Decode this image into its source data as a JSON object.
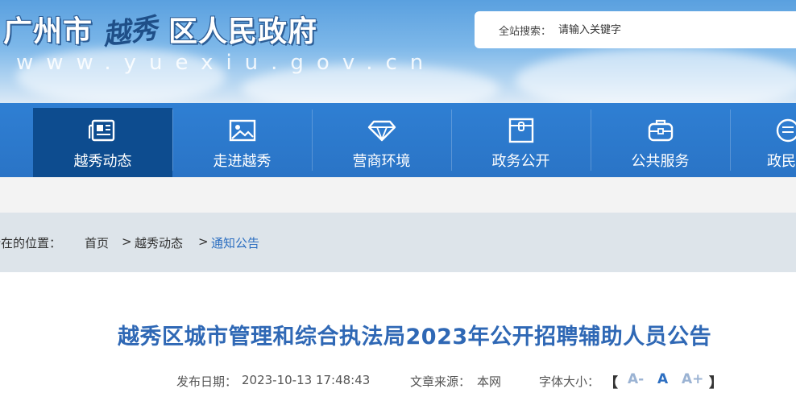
{
  "header": {
    "city": "广州市",
    "district_calligraphy": "越秀",
    "government": "区人民政府",
    "url": "www.yuexiu.gov.cn"
  },
  "search": {
    "label": "全站搜索：",
    "placeholder": "请输入关键字"
  },
  "nav": {
    "items": [
      {
        "label": "越秀动态",
        "icon": "newspaper-icon",
        "active": true
      },
      {
        "label": "走进越秀",
        "icon": "picture-icon",
        "active": false
      },
      {
        "label": "营商环境",
        "icon": "diamond-icon",
        "active": false
      },
      {
        "label": "政务公开",
        "icon": "folder-icon",
        "active": false
      },
      {
        "label": "公共服务",
        "icon": "briefcase-icon",
        "active": false
      },
      {
        "label": "政民",
        "icon": "chat-icon",
        "active": false
      }
    ]
  },
  "breadcrumb": {
    "prefix": "所在的位置：",
    "items": [
      "首页",
      "越秀动态",
      "通知公告"
    ],
    "separator": ">"
  },
  "article": {
    "title": "越秀区城市管理和综合执法局2023年公开招聘辅助人员公告",
    "date_label": "发布日期：",
    "date_value": "2023-10-13 17:48:43",
    "source_label": "文章来源：",
    "source_value": "本网",
    "font_size_label": "字体大小：",
    "bracket_open": "【",
    "font_decrease": "A-",
    "font_normal": "A",
    "font_increase": "A+",
    "bracket_close": "】"
  },
  "colors": {
    "nav_bg": "#2f7fd3",
    "nav_active": "#0d4c8f",
    "title": "#2f68b5",
    "font_ctrl_inactive": "#9bb3d3",
    "font_ctrl_active": "#2d6fc1"
  }
}
